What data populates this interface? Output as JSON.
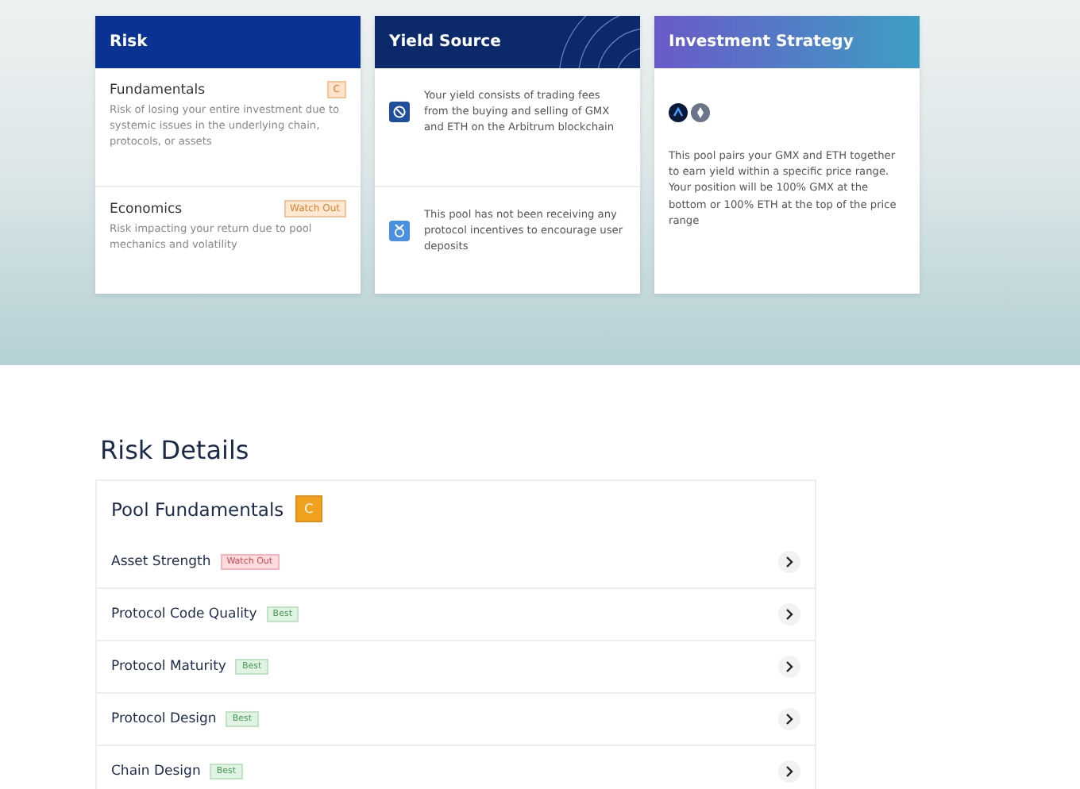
{
  "cards": [
    {
      "title": "Risk",
      "kind": "solid",
      "items": [
        {
          "title": "Fundamentals",
          "text": "Risk of losing your entire investment due to systemic issues in the underlying chain, protocols, or assets",
          "badge": {
            "text": "C",
            "kind": "grade"
          }
        },
        {
          "title": "Economics",
          "text": "Risk impacting your return due to pool mechanics and volatility",
          "badge": {
            "text": "Watch Out",
            "kind": "caution"
          }
        }
      ]
    },
    {
      "title": "Yield Source",
      "kind": "pattern",
      "items": [
        {
          "kind": "fees",
          "text": "Your yield consists of trading fees from the buying and selling of GMX and ETH on the Arbitrum blockchain"
        },
        {
          "kind": "incentive",
          "text": "This pool has not been receiving any protocol incentives to encourage user deposits"
        }
      ]
    },
    {
      "title": "Investment Strategy",
      "kind": "gradient",
      "items": [
        {
          "kind": "tokens",
          "text": "This pool pairs your GMX and ETH together to earn yield within a specific price range. Your position will be 100% GMX at the bottom or 100% ETH at the top of the price range"
        }
      ]
    }
  ],
  "risk_details": {
    "title": "Risk Details",
    "section": {
      "title": "Pool Fundamentals",
      "grade": "C",
      "rows": [
        {
          "label": "Asset Strength",
          "badge": {
            "text": "Watch Out",
            "kind": "danger"
          }
        },
        {
          "label": "Protocol Code Quality",
          "badge": {
            "text": "Best",
            "kind": "good"
          }
        },
        {
          "label": "Protocol Maturity",
          "badge": {
            "text": "Best",
            "kind": "good"
          }
        },
        {
          "label": "Protocol Design",
          "badge": {
            "text": "Best",
            "kind": "good"
          }
        },
        {
          "label": "Chain Design",
          "badge": {
            "text": "Best",
            "kind": "good"
          }
        }
      ]
    }
  }
}
